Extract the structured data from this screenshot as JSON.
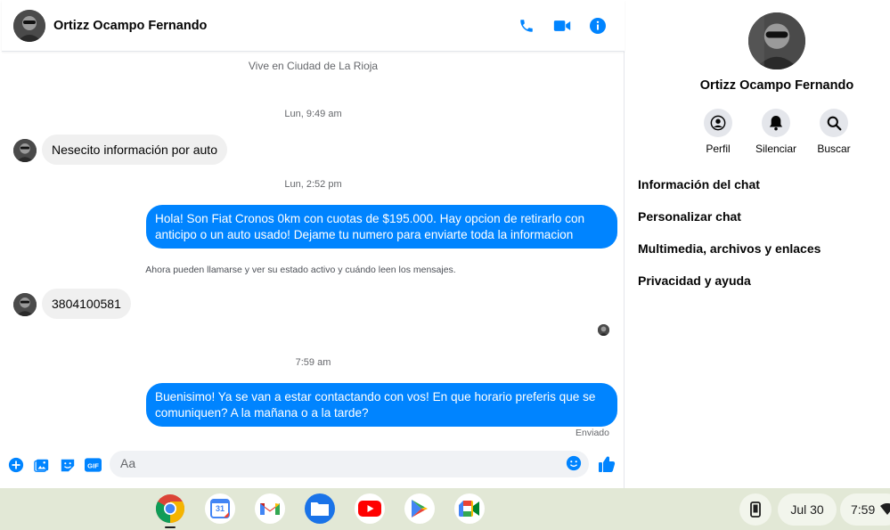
{
  "header": {
    "contact_name": "Ortizz Ocampo Fernando",
    "icons": [
      "phone-icon",
      "video-icon",
      "info-icon"
    ]
  },
  "conversation": {
    "location": "Vive en Ciudad de La Rioja",
    "timestamp_1": "Lun, 9:49 am",
    "msg_1": "Nesecito información por auto",
    "timestamp_2": "Lun, 2:52 pm",
    "msg_2": "Hola! Son Fiat Cronos 0km con cuotas de $195.000. Hay opcion de retirarlo con anticipo o un auto usado! Dejame tu numero para enviarte toda la informacion",
    "system_notice": "Ahora pueden llamarse y ver su estado activo y cuándo leen los mensajes.",
    "msg_3": "3804100581",
    "timestamp_3": "7:59 am",
    "msg_4": "Buenisimo! Ya se van a estar contactando con vos! En que horario preferis que se comuniquen? A la mañana o a la tarde?",
    "status": "Enviado"
  },
  "composer": {
    "placeholder": "Aa"
  },
  "side_panel": {
    "name": "Ortizz Ocampo Fernando",
    "actions": {
      "profile": "Perfil",
      "mute": "Silenciar",
      "search": "Buscar"
    },
    "items": {
      "chat_info": "Información del chat",
      "customize": "Personalizar chat",
      "media": "Multimedia, archivos y enlaces",
      "privacy": "Privacidad y ayuda"
    }
  },
  "shelf": {
    "apps": [
      "chrome-icon",
      "calendar-icon",
      "gmail-icon",
      "files-icon",
      "youtube-icon",
      "play-store-icon",
      "meet-icon"
    ],
    "calendar_day": "31",
    "date": "Jul 30",
    "time": "7:59"
  },
  "colors": {
    "accent": "#0084ff",
    "shelf_bg": "#e2e8d6"
  }
}
